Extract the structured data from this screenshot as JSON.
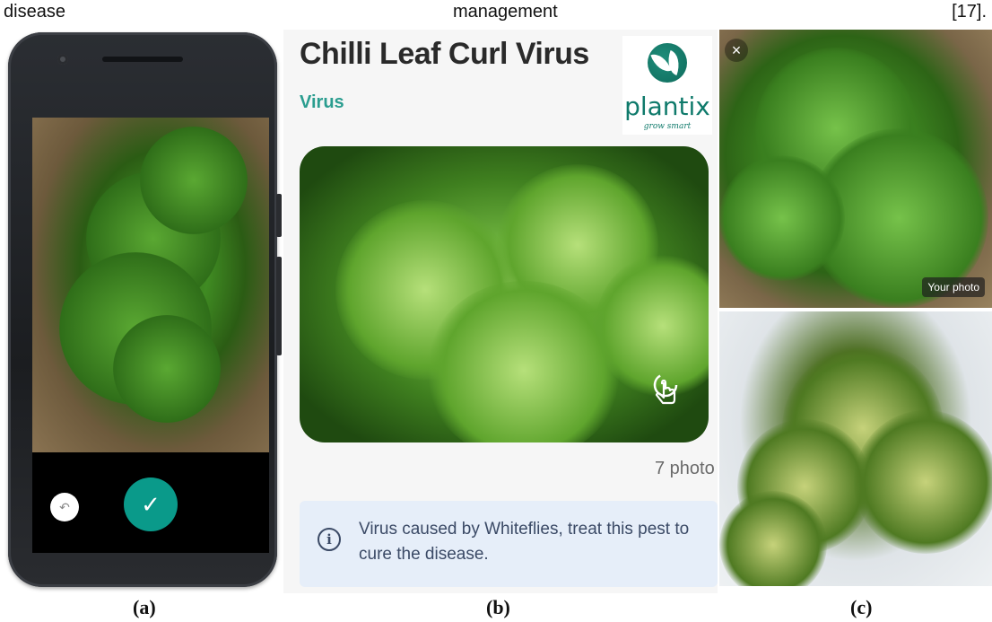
{
  "caption_line": {
    "word1": "disease",
    "word2": "management",
    "word3": "[17]."
  },
  "panel_a": {
    "retake_icon": "undo-icon",
    "confirm_icon": "check-icon",
    "retake_glyph": "↶",
    "confirm_glyph": "✓"
  },
  "panel_b": {
    "title": "Chilli Leaf Curl Virus",
    "type": "Virus",
    "logo": {
      "name": "plantix",
      "tagline": "grow smart"
    },
    "photo_count": "7 photo",
    "info_text": "Virus caused by Whiteflies, treat this pest to cure the disease.",
    "info_glyph": "i",
    "colors": {
      "accent": "#2a9d8f",
      "info_bg": "#e6eef9",
      "info_text": "#3b4a66"
    }
  },
  "panel_c": {
    "close_glyph": "×",
    "your_photo_label": "Your photo"
  },
  "labels": {
    "a": "(a)",
    "b": "(b)",
    "c": "(c)"
  }
}
